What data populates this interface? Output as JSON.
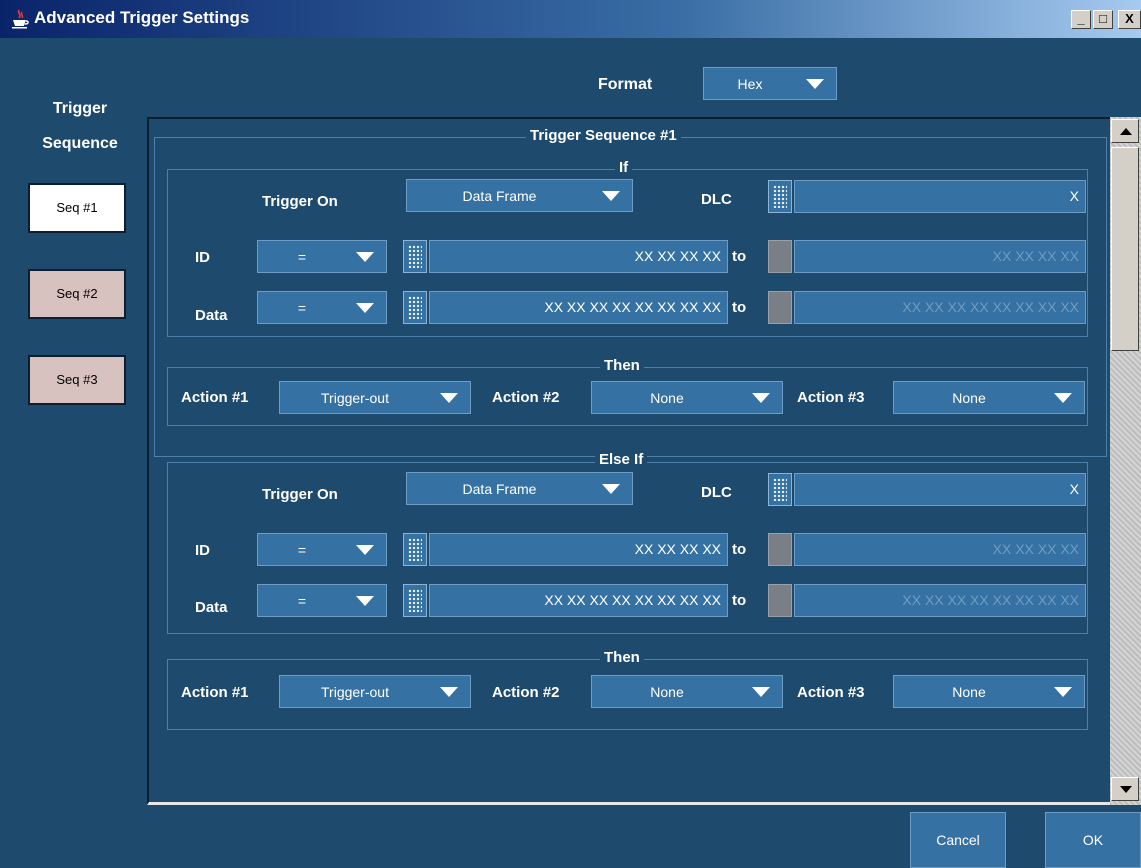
{
  "window": {
    "title": "Advanced Trigger Settings",
    "app_icon": "java-cup-icon",
    "controls": [
      "_",
      "□",
      "X"
    ]
  },
  "sidebar": {
    "title_line1": "Trigger",
    "title_line2": "Sequence",
    "items": [
      {
        "label": "Seq #1",
        "selected": true
      },
      {
        "label": "Seq #2",
        "selected": false
      },
      {
        "label": "Seq #3",
        "selected": false
      }
    ]
  },
  "format": {
    "label": "Format",
    "value": "Hex"
  },
  "panel": {
    "title": "Trigger Sequence #1",
    "if_block": {
      "legend": "If",
      "trigger_on_label": "Trigger On",
      "trigger_on_value": "Data Frame",
      "dlc_label": "DLC",
      "dlc_value": "X",
      "id_label": "ID",
      "id_op": "=",
      "id_from": "XX XX XX XX",
      "id_to_label": "to",
      "id_to": "XX XX XX XX",
      "data_label": "Data",
      "data_op": "=",
      "data_from": "XX XX XX XX XX XX XX XX",
      "data_to_label": "to",
      "data_to": "XX XX XX XX XX XX XX XX"
    },
    "then1": {
      "legend": "Then",
      "action1_label": "Action #1",
      "action1_value": "Trigger-out",
      "action2_label": "Action #2",
      "action2_value": "None",
      "action3_label": "Action #3",
      "action3_value": "None"
    },
    "elseif_block": {
      "legend": "Else If",
      "trigger_on_label": "Trigger On",
      "trigger_on_value": "Data Frame",
      "dlc_label": "DLC",
      "dlc_value": "X",
      "id_label": "ID",
      "id_op": "=",
      "id_from": "XX XX XX XX",
      "id_to_label": "to",
      "id_to": "XX XX XX XX",
      "data_label": "Data",
      "data_op": "=",
      "data_from": "XX XX XX XX XX XX XX XX",
      "data_to_label": "to",
      "data_to": "XX XX XX XX XX XX XX XX"
    },
    "then2": {
      "legend": "Then",
      "action1_label": "Action #1",
      "action1_value": "Trigger-out",
      "action2_label": "Action #2",
      "action2_value": "None",
      "action3_label": "Action #3",
      "action3_value": "None"
    }
  },
  "footer": {
    "cancel_label": "Cancel",
    "ok_label": "OK"
  }
}
